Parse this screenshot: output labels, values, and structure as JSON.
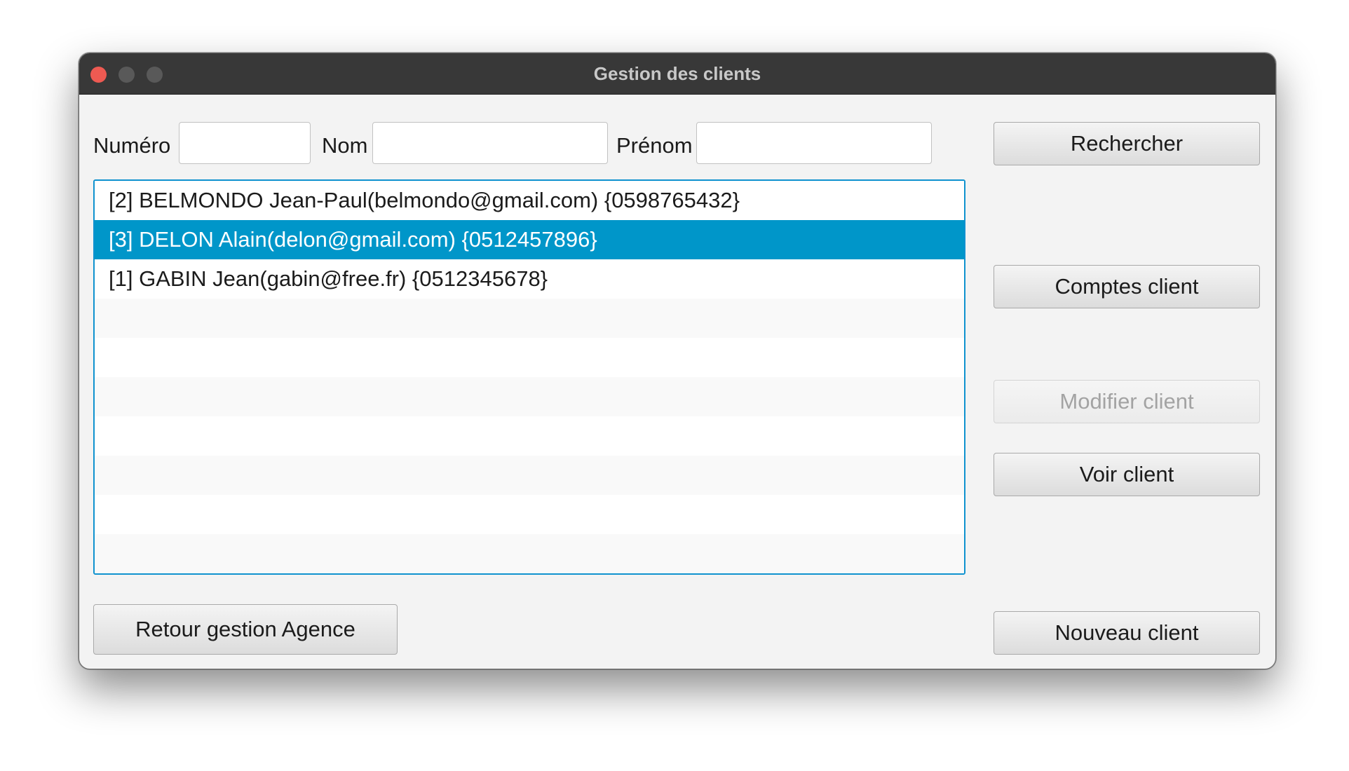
{
  "window": {
    "title": "Gestion des clients"
  },
  "search": {
    "numero_label": "Numéro",
    "numero_value": "",
    "nom_label": "Nom",
    "nom_value": "",
    "prenom_label": "Prénom",
    "prenom_value": ""
  },
  "clients": [
    {
      "text": "[2]  BELMONDO Jean-Paul(belmondo@gmail.com)  {0598765432}",
      "selected": false
    },
    {
      "text": "[3]  DELON Alain(delon@gmail.com)  {0512457896}",
      "selected": true
    },
    {
      "text": "[1]  GABIN Jean(gabin@free.fr)  {0512345678}",
      "selected": false
    }
  ],
  "buttons": {
    "rechercher": "Rechercher",
    "comptes_client": "Comptes client",
    "modifier_client": "Modifier client",
    "voir_client": "Voir client",
    "retour": "Retour gestion Agence",
    "nouveau_client": "Nouveau client"
  },
  "colors": {
    "selection": "#0096c9",
    "focus_border": "#0f92cf",
    "titlebar": "#383838",
    "close_button": "#ee5a52"
  }
}
